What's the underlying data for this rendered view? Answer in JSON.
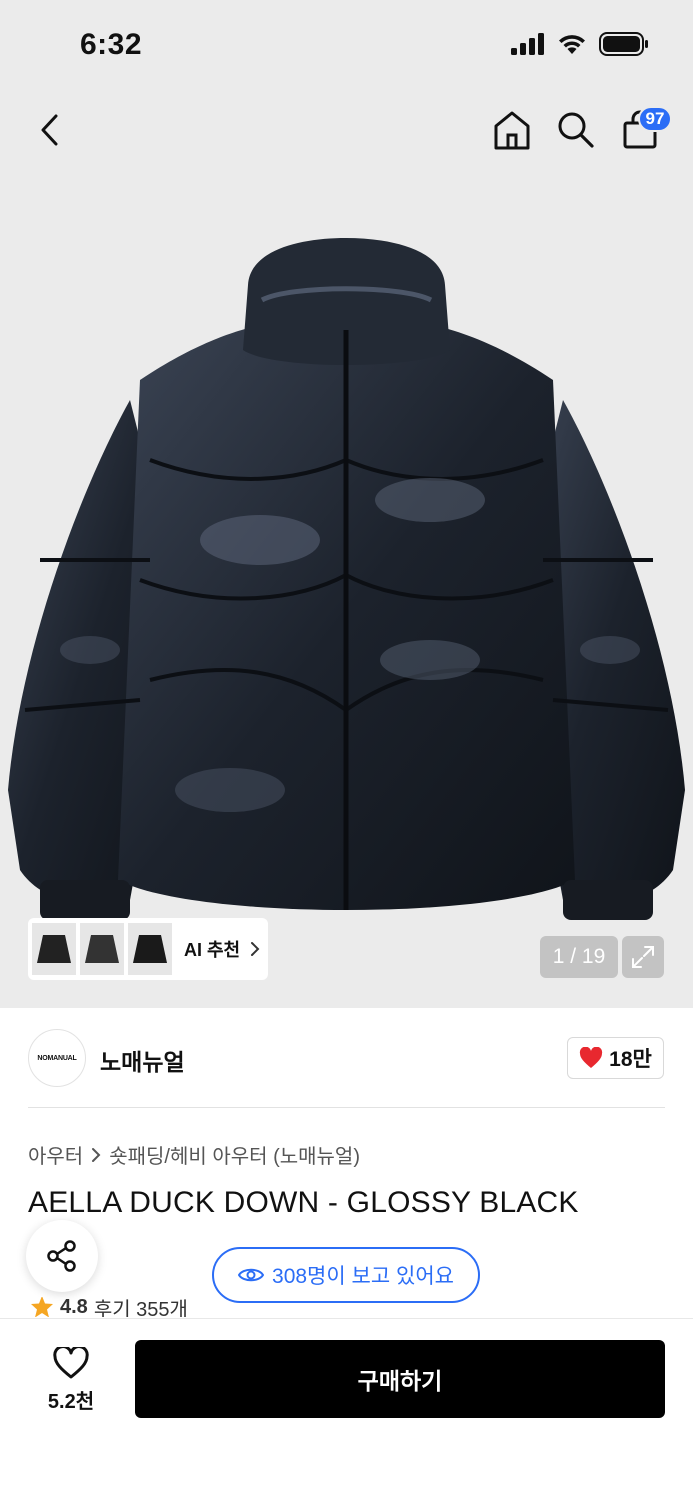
{
  "status_bar": {
    "time": "6:32"
  },
  "nav": {
    "cart_badge": "97"
  },
  "gallery": {
    "ai_label": "AI 추천",
    "counter": "1 / 19"
  },
  "brand": {
    "logo_text": "NOMANUAL",
    "name": "노매뉴얼",
    "likes": "18만"
  },
  "breadcrumb": {
    "category": "아우터",
    "subcategory": "숏패딩/헤비 아우터 (노매뉴얼)"
  },
  "product": {
    "title": "AELLA DUCK DOWN - GLOSSY BLACK",
    "viewers": "308명이 보고 있어요",
    "rating": "4.8",
    "reviews": "후기 355개"
  },
  "bottom": {
    "wish_count": "5.2천",
    "buy_label": "구매하기"
  },
  "colors": {
    "accent": "#2b6df6",
    "heart": "#e8282f",
    "star": "#f5a623"
  }
}
